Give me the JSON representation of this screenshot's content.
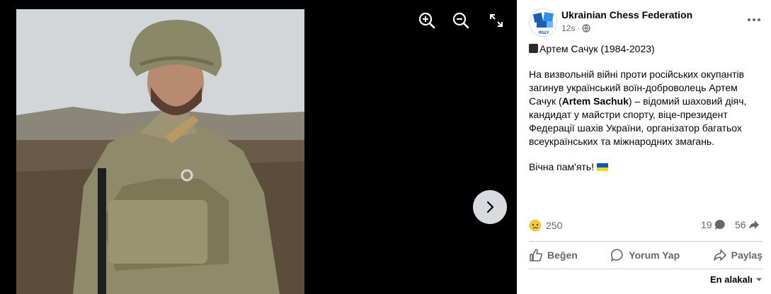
{
  "post": {
    "page_name": "Ukrainian Chess Federation",
    "time": "12s",
    "visibility_icon": "globe-icon",
    "title_line": "Артем Сачук (1984-2023)",
    "body_before": "На визвольній війні проти російських окупантів загинув український воїн-доброволець Артем Сачук (",
    "body_bold": "Artem Sachuk",
    "body_after": ") – відомий шаховий діяч, кандидат у майстри спорту, віце-президент Федерації шахів України, організатор багатьох всеукраїнських та міжнародних змагань.",
    "closing": "Вічна пам'ять!",
    "avatar_caption": "ФШУ"
  },
  "stats": {
    "reactions": "250",
    "comments": "19",
    "shares": "56"
  },
  "actions": {
    "like": "Beğen",
    "comment": "Yorum Yap",
    "share": "Paylaş"
  },
  "sort": {
    "label": "En alakalı"
  },
  "colors": {
    "side_bg": "#ffffff",
    "viewer_bg": "#000000",
    "secondary_text": "#65676b",
    "avatar_blue": "#1c5fb2",
    "flag_blue": "#0057b7",
    "flag_yellow": "#ffd700"
  }
}
